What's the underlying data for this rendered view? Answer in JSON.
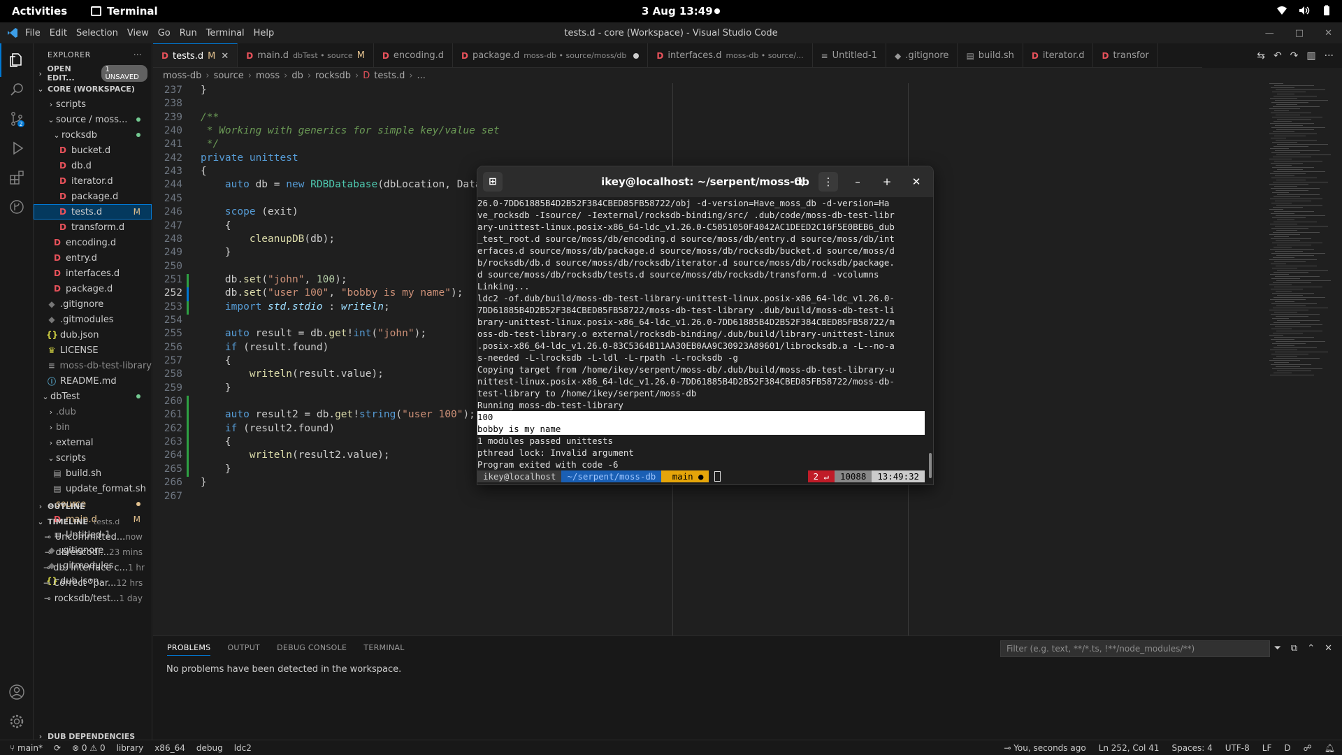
{
  "gnome": {
    "activities": "Activities",
    "app_name": "Terminal",
    "clock": "3 Aug  13:49"
  },
  "window": {
    "menu": [
      "File",
      "Edit",
      "Selection",
      "View",
      "Go",
      "Run",
      "Terminal",
      "Help"
    ],
    "title": "tests.d - core (Workspace) - Visual Studio Code"
  },
  "sidebar": {
    "explorer_label": "EXPLORER",
    "open_editors": "OPEN EDIT...",
    "unsaved_badge": "1 UNSAVED",
    "workspace": "CORE (WORKSPACE)",
    "tree": [
      {
        "label": "scripts",
        "kind": "folder-closed",
        "depth": 1
      },
      {
        "label": "source / moss...",
        "kind": "folder-open",
        "depth": 1,
        "dot": "green"
      },
      {
        "label": "rocksdb",
        "kind": "folder-open",
        "depth": 2,
        "dot": "green"
      },
      {
        "label": "bucket.d",
        "kind": "d",
        "depth": 3
      },
      {
        "label": "db.d",
        "kind": "d",
        "depth": 3
      },
      {
        "label": "iterator.d",
        "kind": "d",
        "depth": 3
      },
      {
        "label": "package.d",
        "kind": "d",
        "depth": 3
      },
      {
        "label": "tests.d",
        "kind": "d",
        "depth": 3,
        "mark": "M",
        "selected": true
      },
      {
        "label": "transform.d",
        "kind": "d",
        "depth": 3
      },
      {
        "label": "encoding.d",
        "kind": "d",
        "depth": 2
      },
      {
        "label": "entry.d",
        "kind": "d",
        "depth": 2
      },
      {
        "label": "interfaces.d",
        "kind": "d",
        "depth": 2
      },
      {
        "label": "package.d",
        "kind": "d",
        "depth": 2
      },
      {
        "label": ".gitignore",
        "kind": "git",
        "depth": 1
      },
      {
        "label": ".gitmodules",
        "kind": "git",
        "depth": 1
      },
      {
        "label": "dub.json",
        "kind": "json",
        "depth": 1
      },
      {
        "label": "LICENSE",
        "kind": "lic",
        "depth": 1
      },
      {
        "label": "moss-db-test-library",
        "kind": "txt",
        "depth": 1,
        "dim": true
      },
      {
        "label": "README.md",
        "kind": "info",
        "depth": 1
      },
      {
        "label": "dbTest",
        "kind": "folder-open",
        "depth": 0,
        "dot": "green"
      },
      {
        "label": ".dub",
        "kind": "folder-closed",
        "depth": 1,
        "dim": true
      },
      {
        "label": "bin",
        "kind": "folder-closed",
        "depth": 1,
        "dim": true
      },
      {
        "label": "external",
        "kind": "folder-closed",
        "depth": 1
      },
      {
        "label": "scripts",
        "kind": "folder-open",
        "depth": 1
      },
      {
        "label": "build.sh",
        "kind": "sh",
        "depth": 2
      },
      {
        "label": "update_format.sh",
        "kind": "sh",
        "depth": 2
      },
      {
        "label": "source",
        "kind": "folder-open",
        "depth": 1,
        "mod": true,
        "dot": "yellow"
      },
      {
        "label": "main.d",
        "kind": "d",
        "depth": 2,
        "mark": "M",
        "mod": true
      },
      {
        "label": "Untitled-1",
        "kind": "txt",
        "depth": 2
      },
      {
        "label": ".gitignore",
        "kind": "git",
        "depth": 1
      },
      {
        "label": ".gitmodules",
        "kind": "git",
        "depth": 1
      },
      {
        "label": "dub.json",
        "kind": "json",
        "depth": 1
      }
    ],
    "outline": "OUTLINE",
    "timeline": "TIMELINE",
    "timeline_file": "tests.d",
    "timeline_items": [
      {
        "label": "Uncommitted...",
        "time": "now"
      },
      {
        "label": "db/encodi...",
        "time": "23 mins"
      },
      {
        "label": "db: Interface c...",
        "time": "1 hr"
      },
      {
        "label": "Correct \"par...",
        "time": "12 hrs"
      },
      {
        "label": "rocksdb/test...",
        "time": "1 day"
      }
    ],
    "dub_deps": "DUB DEPENDENCIES"
  },
  "tabs": [
    {
      "label": "tests.d",
      "desc": "",
      "status": "M",
      "active": true,
      "close": true
    },
    {
      "label": "main.d",
      "desc": "dbTest • source",
      "status": "M"
    },
    {
      "label": "encoding.d",
      "desc": "",
      "status": ""
    },
    {
      "label": "package.d",
      "desc": "moss-db • source/moss/db",
      "status": "dot"
    },
    {
      "label": "interfaces.d",
      "desc": "moss-db • source/...",
      "status": ""
    },
    {
      "label": "Untitled-1",
      "desc": "",
      "status": "",
      "icon": "≡"
    },
    {
      "label": ".gitignore",
      "desc": "",
      "status": "",
      "icon": "◆"
    },
    {
      "label": "build.sh",
      "desc": "",
      "status": "",
      "icon": "▤"
    },
    {
      "label": "iterator.d",
      "desc": "",
      "status": ""
    },
    {
      "label": "transfor",
      "desc": "",
      "status": ""
    }
  ],
  "breadcrumb": [
    "moss-db",
    "source",
    "moss",
    "db",
    "rocksdb",
    "tests.d",
    "..."
  ],
  "editor": {
    "first_line": 237,
    "current_line": 252,
    "lines": [
      [
        [
          "",
          "}"
        ]
      ],
      [],
      [
        [
          "cm",
          "/**"
        ]
      ],
      [
        [
          "cm",
          " * Working with generics for simple key/value set"
        ]
      ],
      [
        [
          "cm",
          " */"
        ]
      ],
      [
        [
          "kw",
          "private"
        ],
        [
          "",
          " "
        ],
        [
          "kw",
          "unittest"
        ]
      ],
      [
        [
          "",
          "{"
        ]
      ],
      [
        [
          "",
          "    "
        ],
        [
          "kw",
          "auto"
        ],
        [
          "",
          " db = "
        ],
        [
          "kw",
          "new"
        ],
        [
          "",
          " "
        ],
        [
          "ty",
          "RDBDatabase"
        ],
        [
          "",
          "(dbLocation, Datab"
        ]
      ],
      [],
      [
        [
          "",
          "    "
        ],
        [
          "kw",
          "scope"
        ],
        [
          "",
          " (exit)"
        ]
      ],
      [
        [
          "",
          "    {"
        ]
      ],
      [
        [
          "",
          "        "
        ],
        [
          "fn",
          "cleanupDB"
        ],
        [
          "",
          "(db);"
        ]
      ],
      [
        [
          "",
          "    }"
        ]
      ],
      [],
      [
        [
          "",
          "    db."
        ],
        [
          "fn",
          "set"
        ],
        [
          "",
          "("
        ],
        [
          "str",
          "\"john\""
        ],
        [
          "",
          ", "
        ],
        [
          "num",
          "100"
        ],
        [
          "",
          ");"
        ]
      ],
      [
        [
          "",
          "    db."
        ],
        [
          "fn",
          "set"
        ],
        [
          "",
          "("
        ],
        [
          "str",
          "\"user 100\""
        ],
        [
          "",
          ", "
        ],
        [
          "str",
          "\"bobby is my name\""
        ],
        [
          "",
          ");"
        ]
      ],
      [
        [
          "",
          "    "
        ],
        [
          "kw",
          "import"
        ],
        [
          "",
          " "
        ],
        [
          "it",
          "std.stdio"
        ],
        [
          "",
          " : "
        ],
        [
          "it",
          "writeln"
        ],
        [
          "",
          ";"
        ]
      ],
      [],
      [
        [
          "",
          "    "
        ],
        [
          "kw",
          "auto"
        ],
        [
          "",
          " result = db."
        ],
        [
          "fn",
          "get"
        ],
        [
          "",
          "!"
        ],
        [
          "kw",
          "int"
        ],
        [
          "",
          "("
        ],
        [
          "str",
          "\"john\""
        ],
        [
          "",
          ");"
        ]
      ],
      [
        [
          "",
          "    "
        ],
        [
          "kw",
          "if"
        ],
        [
          "",
          " (result.found)"
        ]
      ],
      [
        [
          "",
          "    {"
        ]
      ],
      [
        [
          "",
          "        "
        ],
        [
          "fn",
          "writeln"
        ],
        [
          "",
          "(result.value);"
        ]
      ],
      [
        [
          "",
          "    }"
        ]
      ],
      [],
      [
        [
          "",
          "    "
        ],
        [
          "kw",
          "auto"
        ],
        [
          "",
          " result2 = db."
        ],
        [
          "fn",
          "get"
        ],
        [
          "",
          "!"
        ],
        [
          "kw",
          "string"
        ],
        [
          "",
          "("
        ],
        [
          "str",
          "\"user 100\""
        ],
        [
          "",
          ");"
        ]
      ],
      [
        [
          "",
          "    "
        ],
        [
          "kw",
          "if"
        ],
        [
          "",
          " (result2.found)"
        ]
      ],
      [
        [
          "",
          "    {"
        ]
      ],
      [
        [
          "",
          "        "
        ],
        [
          "fn",
          "writeln"
        ],
        [
          "",
          "(result2.value);"
        ]
      ],
      [
        [
          "",
          "    }"
        ]
      ],
      [
        [
          "",
          "}"
        ]
      ],
      []
    ]
  },
  "terminal": {
    "title": "ikey@localhost: ~/serpent/moss-db",
    "lines": [
      "26.0-7DD61885B4D2B52F384CBED85FB58722/obj -d-version=Have_moss_db -d-version=Ha",
      "ve_rocksdb -Isource/ -Iexternal/rocksdb-binding/src/ .dub/code/moss-db-test-libr",
      "ary-unittest-linux.posix-x86_64-ldc_v1.26.0-C5051050F4042AC1DEED2C16F5E0BEB6_dub",
      "_test_root.d source/moss/db/encoding.d source/moss/db/entry.d source/moss/db/int",
      "erfaces.d source/moss/db/package.d source/moss/db/rocksdb/bucket.d source/moss/d",
      "b/rocksdb/db.d source/moss/db/rocksdb/iterator.d source/moss/db/rocksdb/package.",
      "d source/moss/db/rocksdb/tests.d source/moss/db/rocksdb/transform.d -vcolumns",
      "Linking...",
      "ldc2 -of.dub/build/moss-db-test-library-unittest-linux.posix-x86_64-ldc_v1.26.0-",
      "7DD61885B4D2B52F384CBED85FB58722/moss-db-test-library .dub/build/moss-db-test-li",
      "brary-unittest-linux.posix-x86_64-ldc_v1.26.0-7DD61885B4D2B52F384CBED85FB58722/m",
      "oss-db-test-library.o external/rocksdb-binding/.dub/build/library-unittest-linux",
      ".posix-x86_64-ldc_v1.26.0-83C5364B11AA30EB0AA9C30923A89601/librocksdb.a -L--no-a",
      "s-needed -L-lrocksdb -L-ldl -L-rpath -L-rocksdb -g",
      "Copying target from /home/ikey/serpent/moss-db/.dub/build/moss-db-test-library-u",
      "nittest-linux.posix-x86_64-ldc_v1.26.0-7DD61885B4D2B52F384CBED85FB58722/moss-db-",
      "test-library to /home/ikey/serpent/moss-db",
      "Running moss-db-test-library",
      "100",
      "bobby is my name",
      "1 modules passed unittests",
      "pthread lock: Invalid argument",
      "Program exited with code -6"
    ],
    "highlight_from": 18,
    "highlight_to": 19,
    "prompt": {
      "user": "ikey@localhost",
      "dir": "~/serpent/moss-db",
      "branch": " main ●",
      "status": "2 ↵",
      "pid": "10088",
      "time": "13:49:32"
    }
  },
  "panel": {
    "tabs": [
      "PROBLEMS",
      "OUTPUT",
      "DEBUG CONSOLE",
      "TERMINAL"
    ],
    "message": "No problems have been detected in the workspace.",
    "filter_placeholder": "Filter (e.g. text, **/*.ts, !**/node_modules/**)"
  },
  "statusbar": {
    "branch": "main*",
    "problems": "⊗ 0 ⚠ 0",
    "items_left": [
      "library",
      "x86_64",
      "debug",
      "ldc2"
    ],
    "blame": "You, seconds ago",
    "position": "Ln 252, Col 41",
    "spaces": "Spaces: 4",
    "encoding": "UTF-8",
    "eol": "LF",
    "lang": "D"
  }
}
